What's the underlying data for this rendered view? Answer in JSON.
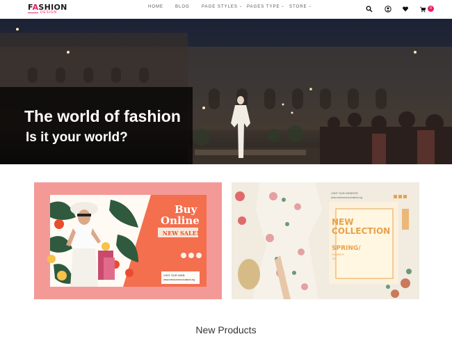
{
  "logo": {
    "main_prefix": "F",
    "main_accent": "A",
    "main_rest": "SHION",
    "sub": "DESIGN"
  },
  "nav": {
    "items": [
      {
        "label": "HOME",
        "has_dropdown": false
      },
      {
        "label": "BLOG",
        "has_dropdown": false
      },
      {
        "label": "PAGE STYLES",
        "has_dropdown": true
      },
      {
        "label": "PAGES TYPE",
        "has_dropdown": true
      },
      {
        "label": "STORE",
        "has_dropdown": true
      }
    ],
    "chevron": "⌄"
  },
  "header_icons": [
    "search-icon",
    "user-icon",
    "heart-icon",
    "cart-icon"
  ],
  "cart_count": "0",
  "hero": {
    "title": "The world of fashion",
    "subtitle": "Is it your world?"
  },
  "banner_left": {
    "heading_line1": "Buy",
    "heading_line2": "Online",
    "tag": "NEW SALE!",
    "footer_label": "VISIT OUR WEB:",
    "footer_url": "www.webcommunications.bg"
  },
  "banner_right": {
    "top_label": "VISIT OUR WEBSITE",
    "top_url": "www.webcommunications.bg",
    "heading_line1": "NEW",
    "heading_line2": "COLLECTION",
    "season_line1": "SPRING/",
    "season_line2": "SUMMER",
    "year": "'20"
  },
  "new_products": {
    "title": "New Products"
  },
  "colors": {
    "accent": "#e91e63",
    "banner_pink": "#f49a96",
    "banner_orange": "#f36f4e",
    "banner_cream": "#f1ebe0",
    "banner_gold": "#e8a24c"
  }
}
